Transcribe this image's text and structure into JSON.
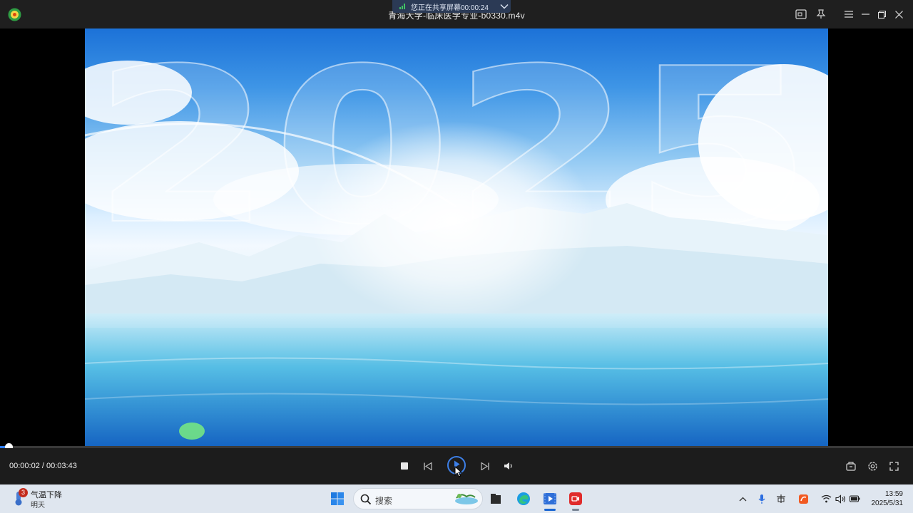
{
  "titlebar": {
    "file_title": "青海大学-临床医学专业-b0330.m4v",
    "share_banner": "您正在共享屏幕00:00:24",
    "icons": [
      "app-logo-icon",
      "screenshot-icon",
      "pin-icon",
      "menu-icon",
      "minimize-icon",
      "restore-icon",
      "close-icon"
    ]
  },
  "video": {
    "overlay_text": "2025"
  },
  "player": {
    "progress_fraction": 0.009,
    "time_readout": "00:00:02 / 00:03:43",
    "accent_color": "#2d7df6",
    "controls": [
      "stop-icon",
      "previous-icon",
      "play-icon",
      "next-icon",
      "volume-icon",
      "playlist-icon",
      "settings-icon",
      "fullscreen-icon"
    ]
  },
  "taskbar": {
    "weather": {
      "badge": "3",
      "line1": "气温下降",
      "line2": "明天"
    },
    "search_placeholder": "搜索",
    "clock": {
      "time": "13:59",
      "date": "2025/5/31"
    },
    "apps": [
      "windows-start-icon",
      "file-explorer-icon",
      "edge-icon",
      "video-player-icon",
      "screen-recorder-icon"
    ],
    "tray": [
      "chevron-up-icon",
      "microphone-icon",
      "input-method-icon",
      "security-icon",
      "wifi-icon",
      "speaker-icon",
      "battery-icon"
    ]
  }
}
